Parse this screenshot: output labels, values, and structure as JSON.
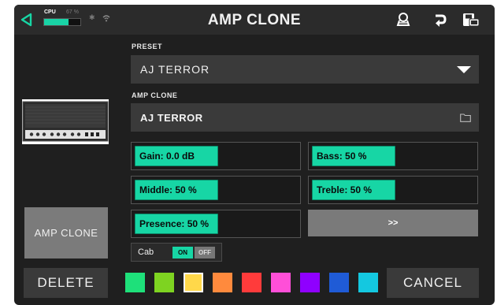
{
  "header": {
    "title": "AMP CLONE",
    "cpu_label": "CPU",
    "cpu_percent_text": "67 %",
    "cpu_level": 0.67,
    "icons": [
      "back-icon",
      "bluetooth-icon",
      "wifi-icon",
      "tuner-icon",
      "undo-icon",
      "save-icon"
    ]
  },
  "preset": {
    "label": "PRESET",
    "value": "AJ TERROR"
  },
  "amp_clone": {
    "label": "AMP CLONE",
    "value": "AJ TERROR"
  },
  "params": [
    {
      "text": "Gain: 0.0 dB"
    },
    {
      "text": "Bass: 50 %"
    },
    {
      "text": "Middle: 50 %"
    },
    {
      "text": "Treble: 50 %"
    },
    {
      "text": "Presence: 50 %"
    }
  ],
  "more_label": ">>",
  "cab": {
    "label": "Cab",
    "on": "ON",
    "off": "OFF",
    "state": "ON"
  },
  "amp_clone_button": "AMP CLONE",
  "delete_label": "DELETE",
  "cancel_label": "CANCEL",
  "colors": {
    "accent": "#17d6a5",
    "swatches": [
      "#1ee07a",
      "#7ed321",
      "#ffd84a",
      "#ff8a3d",
      "#ff3b3b",
      "#ff4fd8",
      "#8f00ff",
      "#1f5bd6",
      "#14c8e0"
    ],
    "selected_swatch": "#ffd84a"
  }
}
